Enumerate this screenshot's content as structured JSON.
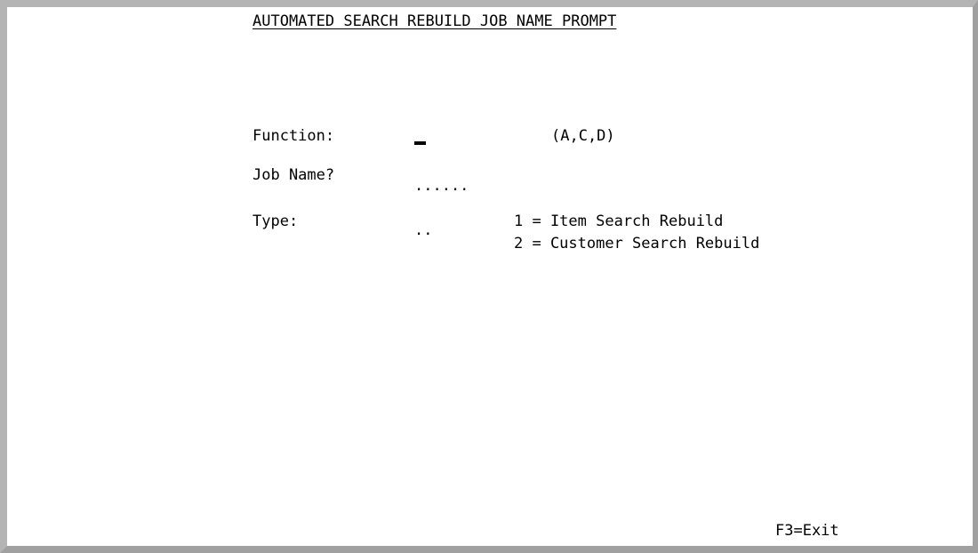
{
  "screen": {
    "title": "AUTOMATED SEARCH REBUILD JOB NAME PROMPT"
  },
  "fields": {
    "function": {
      "label": "Function:",
      "value": "",
      "hint": "(A,C,D)"
    },
    "job_name": {
      "label": "Job Name?",
      "placeholder": "......"
    },
    "type": {
      "label": "Type:",
      "placeholder": "..",
      "options": [
        "1 = Item Search Rebuild",
        "2 = Customer Search Rebuild"
      ]
    }
  },
  "function_keys": {
    "exit": "F3=Exit"
  },
  "colors": {
    "background": "#ffffff",
    "text": "#000000",
    "frame_light": "#b4b4b4",
    "frame_dark": "#a0a0a0"
  }
}
